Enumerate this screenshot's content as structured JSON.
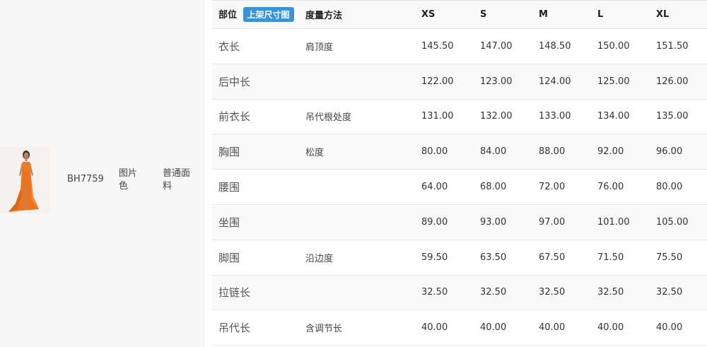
{
  "product": {
    "sku": "BH7759",
    "color": "图片色",
    "fabric": "普通面料",
    "image_icon": "dress-photo"
  },
  "size_table": {
    "header": {
      "part": "部位",
      "badge": "上架尺寸图",
      "method": "度量方法",
      "sizes": [
        "XS",
        "S",
        "M",
        "L",
        "XL"
      ]
    },
    "rows": [
      {
        "part": "衣长",
        "method": "肩顶度",
        "values": [
          "145.50",
          "147.00",
          "148.50",
          "150.00",
          "151.50"
        ]
      },
      {
        "part": "后中长",
        "method": "",
        "values": [
          "122.00",
          "123.00",
          "124.00",
          "125.00",
          "126.00"
        ]
      },
      {
        "part": "前衣长",
        "method": "吊代根处度",
        "values": [
          "131.00",
          "132.00",
          "133.00",
          "134.00",
          "135.00"
        ]
      },
      {
        "part": "胸围",
        "method": "松度",
        "values": [
          "80.00",
          "84.00",
          "88.00",
          "92.00",
          "96.00"
        ]
      },
      {
        "part": "腰围",
        "method": "",
        "values": [
          "64.00",
          "68.00",
          "72.00",
          "76.00",
          "80.00"
        ]
      },
      {
        "part": "坐围",
        "method": "",
        "values": [
          "89.00",
          "93.00",
          "97.00",
          "101.00",
          "105.00"
        ]
      },
      {
        "part": "脚围",
        "method": "沿边度",
        "values": [
          "59.50",
          "63.50",
          "67.50",
          "71.50",
          "75.50"
        ]
      },
      {
        "part": "拉链长",
        "method": "",
        "values": [
          "32.50",
          "32.50",
          "32.50",
          "32.50",
          "32.50"
        ]
      },
      {
        "part": "吊代长",
        "method": "含调节长",
        "values": [
          "40.00",
          "40.00",
          "40.00",
          "40.00",
          "40.00"
        ]
      }
    ]
  },
  "colors": {
    "badge_bg": "#3a93d8",
    "dress": "#ee7a22"
  }
}
